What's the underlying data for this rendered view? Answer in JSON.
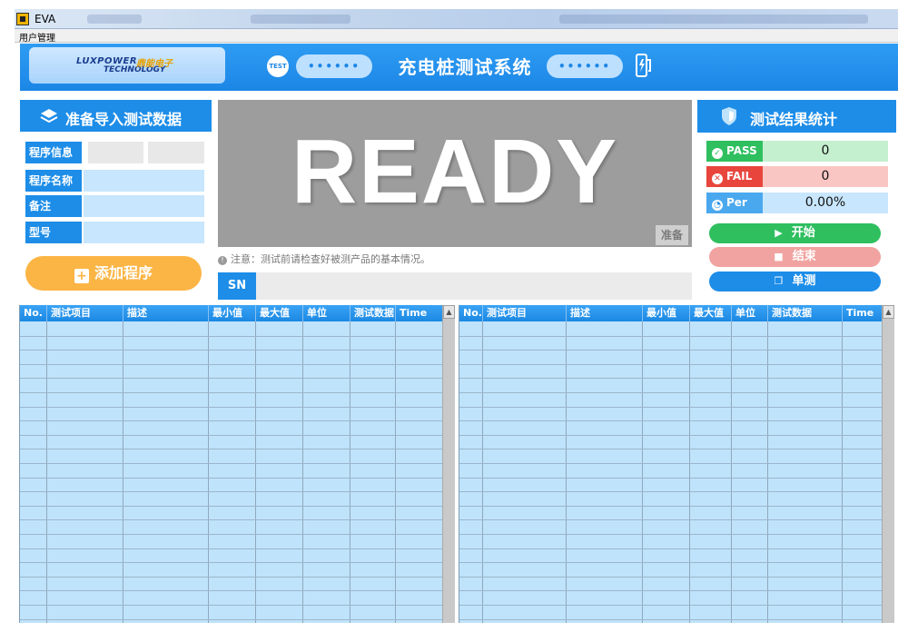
{
  "window": {
    "title": "EVA"
  },
  "menu": {
    "items": [
      "用户管理"
    ]
  },
  "header": {
    "logo_en_line1": "LUXPOWER",
    "logo_en_line2": "TECHNOLOGY",
    "logo_cn": "鼎能电子",
    "test_badge": "TEST",
    "dots": "••••••",
    "title": "充电桩测试系统"
  },
  "left_panel": {
    "title": "准备导入测试数据",
    "rows": [
      {
        "label": "程序信息"
      },
      {
        "label": "程序名称"
      },
      {
        "label": "备注"
      },
      {
        "label": "型号"
      }
    ],
    "add_button": "添加程序"
  },
  "center": {
    "status_big": "READY",
    "status_small": "准备",
    "notice": "注意：测试前请检查好被测产品的基本情况。",
    "sn_label": "SN",
    "sn_value": ""
  },
  "right_panel": {
    "title": "测试结果统计",
    "pass_label": "PASS",
    "pass_value": "0",
    "fail_label": "FAIL",
    "fail_value": "0",
    "per_label": "Per",
    "per_value": "0.00%",
    "start_button": "开始",
    "stop_button": "结束",
    "single_button": "单测"
  },
  "tables": {
    "columns": [
      "No.",
      "测试项目",
      "描述",
      "最小值",
      "最大值",
      "单位",
      "测试数据",
      "Time"
    ]
  },
  "colors": {
    "primary": "#1d8de8",
    "accent_orange": "#fbb545",
    "pass_green": "#2fbf5f",
    "fail_red": "#e8453c",
    "table_bg": "#bfe3fb"
  }
}
